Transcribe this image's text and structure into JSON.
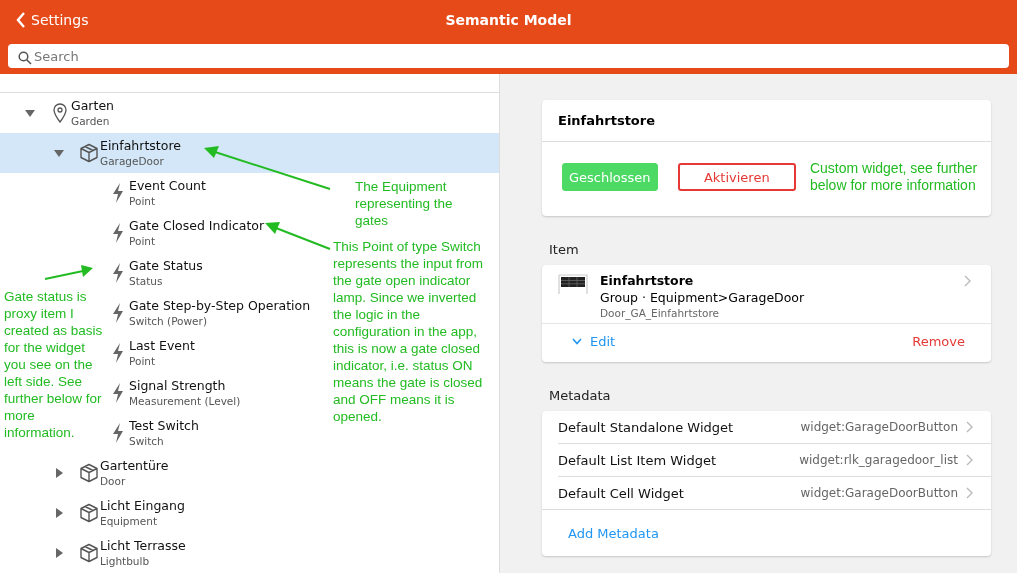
{
  "header": {
    "back_label": "Settings",
    "title": "Semantic Model"
  },
  "search": {
    "placeholder": "Search"
  },
  "tree": [
    {
      "label": "Garten",
      "type": "Garden",
      "kind": "location",
      "expanded": true,
      "selected": false,
      "children": [
        {
          "label": "Einfahrtstore",
          "type": "GarageDoor",
          "kind": "equipment",
          "expanded": true,
          "selected": true,
          "children": [
            {
              "label": "Event Count",
              "type": "Point",
              "kind": "point",
              "selected": false
            },
            {
              "label": "Gate Closed Indicator",
              "type": "Point",
              "kind": "point",
              "selected": false
            },
            {
              "label": "Gate Status",
              "type": "Status",
              "kind": "point",
              "selected": false
            },
            {
              "label": "Gate Step-by-Step Operation",
              "type": "Switch (Power)",
              "kind": "point",
              "selected": false
            },
            {
              "label": "Last Event",
              "type": "Point",
              "kind": "point",
              "selected": false
            },
            {
              "label": "Signal Strength",
              "type": "Measurement (Level)",
              "kind": "point",
              "selected": false
            },
            {
              "label": "Test Switch",
              "type": "Switch",
              "kind": "point",
              "selected": false
            }
          ]
        },
        {
          "label": "Gartentüre",
          "type": "Door",
          "kind": "equipment",
          "expanded": false,
          "selected": false
        },
        {
          "label": "Licht Eingang",
          "type": "Equipment",
          "kind": "equipment",
          "expanded": false,
          "selected": false
        },
        {
          "label": "Licht Terrasse",
          "type": "Lightbulb",
          "kind": "equipment",
          "expanded": false,
          "selected": false
        }
      ]
    }
  ],
  "annotations": [
    {
      "text": "The Equipment representing the gates"
    },
    {
      "text": "Gate status is proxy item I created as basis for the widget you see on the left side. See further below for more information."
    },
    {
      "text": "This Point of type Switch represents the input from the gate open indicator lamp. Since we inverted the logic in the configuration in the app, this is now a gate closed indicator, i.e. status ON means the gate is closed and OFF means it is opened."
    }
  ],
  "widget_card": {
    "title": "Einfahrtstore",
    "buttons": [
      {
        "label": "Geschlossen",
        "kind": "filled"
      },
      {
        "label": "Aktivieren",
        "kind": "outline"
      }
    ],
    "annotation": "Custom widget, see further below for more information"
  },
  "item": {
    "heading": "Item",
    "name": "Einfahrtstore",
    "type": "Group · Equipment>GarageDoor",
    "id": "Door_GA_Einfahrtstore",
    "edit": "Edit",
    "remove": "Remove"
  },
  "metadata": {
    "heading": "Metadata",
    "rows": [
      {
        "label": "Default Standalone Widget",
        "value": "widget:GarageDoorButton"
      },
      {
        "label": "Default List Item Widget",
        "value": "widget:rlk_garagedoor_list"
      },
      {
        "label": "Default Cell Widget",
        "value": "widget:GarageDoorButton"
      }
    ],
    "add": "Add Metadata"
  }
}
